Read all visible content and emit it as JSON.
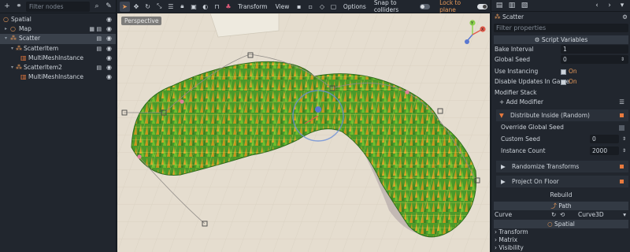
{
  "left_panel": {
    "filter_placeholder": "Filter nodes",
    "nodes": [
      {
        "label": "Spatial",
        "icon": "spatial-node-icon",
        "color": "#e89a5a"
      },
      {
        "label": "Map",
        "icon": "node-icon",
        "color": "#e89a5a"
      },
      {
        "label": "Scatter",
        "icon": "scatter-node-icon",
        "color": "#e89a5a"
      },
      {
        "label": "ScatterItem",
        "icon": "scatter-item-node-icon",
        "color": "#e89a5a"
      },
      {
        "label": "MultiMeshInstance",
        "icon": "multimesh-icon",
        "color": "#e87a3e"
      },
      {
        "label": "ScatterItem2",
        "icon": "scatter-item-node-icon",
        "color": "#e89a5a"
      },
      {
        "label": "MultiMeshInstance",
        "icon": "multimesh-icon",
        "color": "#e87a3e"
      }
    ]
  },
  "viewport": {
    "menu_transform": "Transform",
    "menu_view": "View",
    "options": "Options",
    "snap_label": "Snap to colliders",
    "lock_label": "Lock to plane",
    "perspective": "Perspective",
    "axis_y": "Y",
    "axis_x": "X"
  },
  "inspector": {
    "node_name": "Scatter",
    "filter_placeholder": "Filter properties",
    "script_variables": "Script Variables",
    "bake_interval_label": "Bake Interval",
    "bake_interval_value": "1",
    "global_seed_label": "Global Seed",
    "global_seed_value": "0",
    "use_instancing_label": "Use Instancing",
    "use_instancing_value": "On",
    "disable_updates_label": "Disable Updates In Game",
    "disable_updates_value": "On",
    "modifier_stack_label": "Modifier Stack",
    "add_modifier": "Add Modifier",
    "modifier1": "Distribute Inside (Random)",
    "override_seed_label": "Override Global Seed",
    "custom_seed_label": "Custom Seed",
    "custom_seed_value": "0",
    "instance_count_label": "Instance Count",
    "instance_count_value": "2000",
    "modifier2": "Randomize Transforms",
    "modifier3": "Project On Floor",
    "rebuild": "Rebuild",
    "path_header": "Path",
    "curve_label": "Curve",
    "curve_value": "Curve3D",
    "spatial_header": "Spatial",
    "transform_label": "Transform",
    "matrix_label": "Matrix",
    "visibility_label": "Visibility"
  },
  "colors": {
    "accent": "#e89a5a",
    "panel": "#21262e",
    "grass": "#4a9a2a",
    "floor": "#e5ddcf"
  }
}
